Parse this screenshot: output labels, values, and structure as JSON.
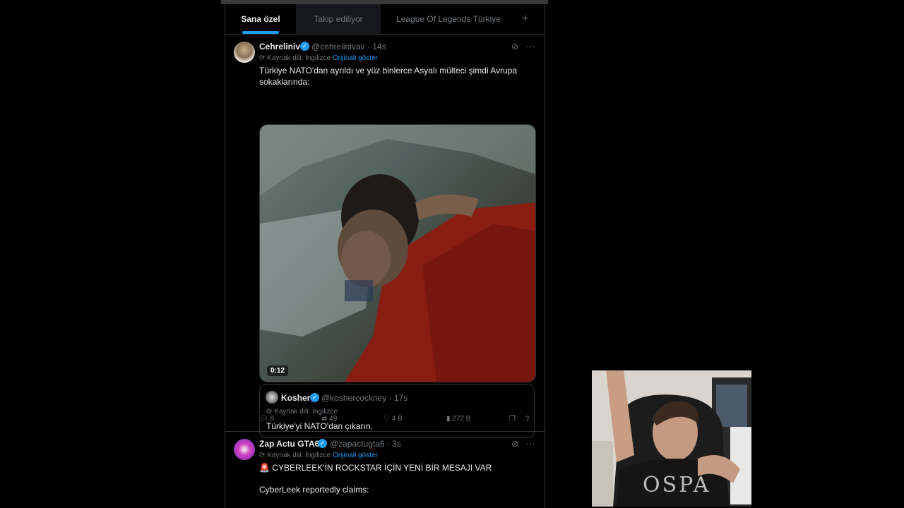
{
  "tabs": [
    "Sana özel",
    "Takip ediliyor",
    "League Of Legends Türkiye"
  ],
  "tab_add_label": "+",
  "tweet1": {
    "name": "Cehreliniv",
    "handle": "@cehrelinivav",
    "time": "14s",
    "source_label": "Kaynak dili: İngilizce",
    "source_link": "Orijinali göster",
    "text": "Türkiye NATO'dan ayrıldı ve yüz binlerce Asyalı mülteci şimdi Avrupa sokaklarında:",
    "video_duration": "0:12",
    "quote": {
      "name": "Kosher",
      "handle": "@koshercockney",
      "time": "17s",
      "source_label": "Kaynak dili: İngilizce",
      "text": "Türkiye'yi NATO'dan çıkarın."
    },
    "stats": {
      "replies": "8",
      "reposts": "49",
      "likes": "4 B",
      "views": "272 B"
    }
  },
  "tweet2": {
    "name": "Zap Actu GTA6",
    "handle": "@zapactugta6",
    "time": "3s",
    "source_label": "Kaynak dili: İngilizce",
    "source_link": "Orijinali göster",
    "text_line1": "🚨 CYBERLEEK'İN ROCKSTAR İÇİN YENİ BİR MESAJI VAR",
    "text_line2": "CyberLeek reportedly claims:"
  },
  "webcam_shirt_text": "OSPA",
  "colors": {
    "accent": "#1d9bf0",
    "bg": "#000000",
    "muted": "#71767b",
    "border": "#2f3336"
  }
}
